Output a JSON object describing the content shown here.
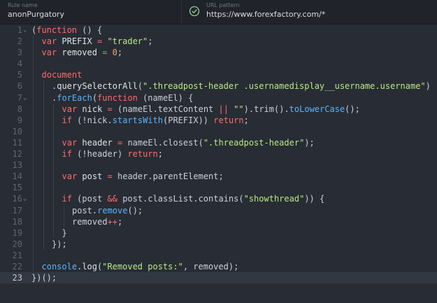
{
  "header": {
    "rule_name_label": "Rule name",
    "rule_name_value": "anonPurgatory",
    "url_pattern_label": "URL pattern",
    "url_pattern_value": "https://www.forexfactory.com/*",
    "accent_color": "#8fd18f"
  },
  "editor": {
    "active_line": 23,
    "lines": [
      {
        "n": "1",
        "fold": "v",
        "indent": 0,
        "tokens": [
          [
            "pl",
            "("
          ],
          [
            "kw",
            "function"
          ],
          [
            "pl",
            " () {"
          ]
        ]
      },
      {
        "n": "2",
        "fold": "",
        "indent": 1,
        "tokens": [
          [
            "kw",
            "var"
          ],
          [
            "id",
            " PREFIX "
          ],
          [
            "op",
            "="
          ],
          [
            "str",
            " \"trader\""
          ],
          [
            "pl",
            ";"
          ]
        ]
      },
      {
        "n": "3",
        "fold": "",
        "indent": 1,
        "tokens": [
          [
            "kw",
            "var"
          ],
          [
            "id",
            " removed "
          ],
          [
            "op",
            "="
          ],
          [
            "num",
            " 0"
          ],
          [
            "pl",
            ";"
          ]
        ]
      },
      {
        "n": "4",
        "fold": "",
        "indent": 1,
        "tokens": []
      },
      {
        "n": "5",
        "fold": "",
        "indent": 1,
        "tokens": [
          [
            "kw",
            "document"
          ]
        ]
      },
      {
        "n": "6",
        "fold": "",
        "indent": 2,
        "tokens": [
          [
            "pl",
            "."
          ],
          [
            "id",
            "querySelectorAll"
          ],
          [
            "pl",
            "("
          ],
          [
            "str",
            "\".threadpost-header .usernamedisplay__username.username\""
          ],
          [
            "pl",
            ")"
          ]
        ]
      },
      {
        "n": "7",
        "fold": "v",
        "indent": 2,
        "tokens": [
          [
            "pl",
            "."
          ],
          [
            "fn",
            "forEach"
          ],
          [
            "pl",
            "("
          ],
          [
            "kw",
            "function"
          ],
          [
            "pl",
            " (nameEl) {"
          ]
        ]
      },
      {
        "n": "8",
        "fold": "",
        "indent": 3,
        "tokens": [
          [
            "kw",
            "var"
          ],
          [
            "id",
            " nick "
          ],
          [
            "op",
            "="
          ],
          [
            "pl",
            " (nameEl.textContent "
          ],
          [
            "op",
            "||"
          ],
          [
            "str",
            " \"\""
          ],
          [
            "pl",
            ").trim()."
          ],
          [
            "fn",
            "toLowerCase"
          ],
          [
            "pl",
            "();"
          ]
        ]
      },
      {
        "n": "9",
        "fold": "",
        "indent": 3,
        "tokens": [
          [
            "kw",
            "if"
          ],
          [
            "pl",
            " (!nick."
          ],
          [
            "fn",
            "startsWith"
          ],
          [
            "pl",
            "(PREFIX)) "
          ],
          [
            "kw",
            "return"
          ],
          [
            "pl",
            ";"
          ]
        ]
      },
      {
        "n": "10",
        "fold": "",
        "indent": 3,
        "tokens": []
      },
      {
        "n": "11",
        "fold": "",
        "indent": 3,
        "tokens": [
          [
            "kw",
            "var"
          ],
          [
            "id",
            " header "
          ],
          [
            "op",
            "="
          ],
          [
            "pl",
            " nameEl.closest("
          ],
          [
            "str",
            "\".threadpost-header\""
          ],
          [
            "pl",
            ");"
          ]
        ]
      },
      {
        "n": "12",
        "fold": "",
        "indent": 3,
        "tokens": [
          [
            "kw",
            "if"
          ],
          [
            "pl",
            " (!header) "
          ],
          [
            "kw",
            "return"
          ],
          [
            "pl",
            ";"
          ]
        ]
      },
      {
        "n": "13",
        "fold": "",
        "indent": 3,
        "tokens": []
      },
      {
        "n": "14",
        "fold": "",
        "indent": 3,
        "tokens": [
          [
            "kw",
            "var"
          ],
          [
            "id",
            " post "
          ],
          [
            "op",
            "="
          ],
          [
            "pl",
            " header.parentElement;"
          ]
        ]
      },
      {
        "n": "15",
        "fold": "",
        "indent": 3,
        "tokens": []
      },
      {
        "n": "16",
        "fold": "v",
        "indent": 3,
        "tokens": [
          [
            "kw",
            "if"
          ],
          [
            "pl",
            " (post "
          ],
          [
            "op",
            "&&"
          ],
          [
            "pl",
            " post.classList.contains("
          ],
          [
            "str",
            "\"showthread\""
          ],
          [
            "pl",
            ")) {"
          ]
        ]
      },
      {
        "n": "17",
        "fold": "",
        "indent": 4,
        "tokens": [
          [
            "pl",
            "post."
          ],
          [
            "fn",
            "remove"
          ],
          [
            "pl",
            "();"
          ]
        ]
      },
      {
        "n": "18",
        "fold": "",
        "indent": 4,
        "tokens": [
          [
            "pl",
            "removed"
          ],
          [
            "op",
            "++"
          ],
          [
            "pl",
            ";"
          ]
        ]
      },
      {
        "n": "19",
        "fold": "",
        "indent": 3,
        "tokens": [
          [
            "pl",
            "}"
          ]
        ]
      },
      {
        "n": "20",
        "fold": "",
        "indent": 2,
        "tokens": [
          [
            "pl",
            "});"
          ]
        ]
      },
      {
        "n": "21",
        "fold": "",
        "indent": 1,
        "tokens": []
      },
      {
        "n": "22",
        "fold": "",
        "indent": 1,
        "tokens": [
          [
            "fn",
            "console"
          ],
          [
            "pl",
            "."
          ],
          [
            "id",
            "log"
          ],
          [
            "pl",
            "("
          ],
          [
            "str",
            "\"Removed posts:\""
          ],
          [
            "pl",
            ", removed);"
          ]
        ]
      },
      {
        "n": "23",
        "fold": "",
        "indent": 0,
        "tokens": [
          [
            "pl",
            "})();"
          ]
        ]
      }
    ]
  }
}
